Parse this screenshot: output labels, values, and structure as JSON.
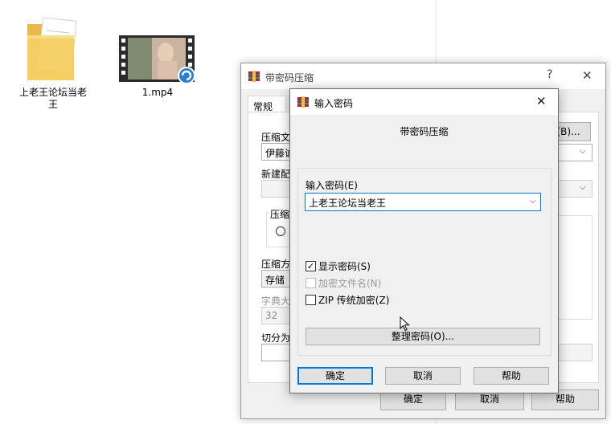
{
  "desktop": {
    "folder_label_line1": "上老王论坛当老",
    "folder_label_line2": "王",
    "video_label": "1.mp4"
  },
  "back_window": {
    "title": "带密码压缩",
    "help_glyph": "?",
    "close_glyph": "✕",
    "tab_general": "常规",
    "label_archive_name": "压缩文",
    "archive_name_value": "伊藤诚",
    "browse_button": "(B)...",
    "label_update_mode": "新建配",
    "label_archive_format": "压缩",
    "label_compression_method": "压缩方",
    "compression_method_value": "存储",
    "label_dictionary_size": "字典大",
    "dictionary_size_value": "32",
    "label_split": "切分为",
    "ok_button": "确定",
    "cancel_button": "取消",
    "help_button": "帮助"
  },
  "dialog": {
    "title": "输入密码",
    "close_glyph": "✕",
    "subtitle": "带密码压缩",
    "label_password": "输入密码(E)",
    "password_value": "上老王论坛当老王",
    "show_password_label": "显示密码(S)",
    "show_password_checked": true,
    "encrypt_filenames_label": "加密文件名(N)",
    "encrypt_filenames_checked": false,
    "zip_legacy_label": "ZIP 传统加密(Z)",
    "zip_legacy_checked": false,
    "organize_button": "整理密码(O)...",
    "ok_button": "确定",
    "cancel_button": "取消",
    "help_button": "帮助",
    "check_glyph": "✓"
  },
  "colors": {
    "accent": "#0078d7",
    "winrar_red": "#b5262b",
    "folder_yellow": "#f5cf62",
    "video_badge": "#2a7fd4"
  }
}
